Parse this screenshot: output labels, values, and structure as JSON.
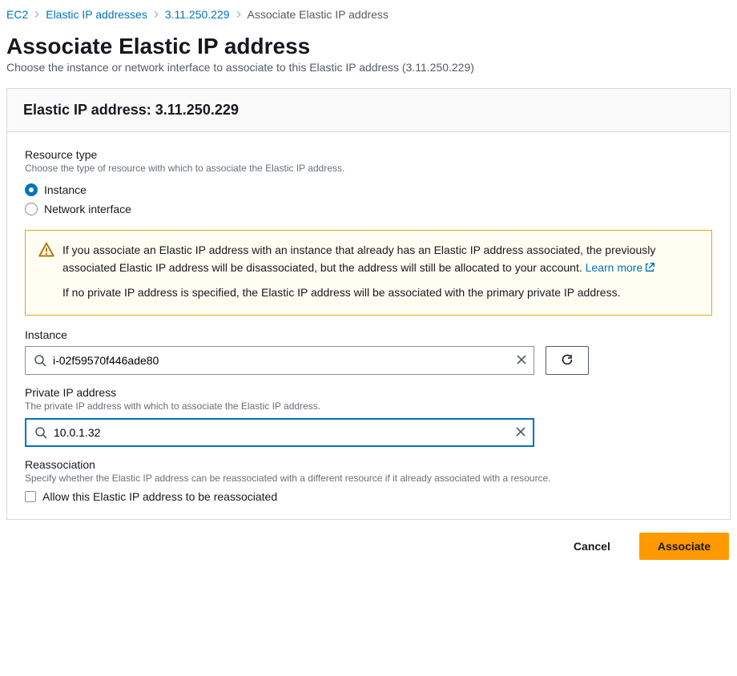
{
  "breadcrumb": {
    "items": [
      {
        "label": "EC2"
      },
      {
        "label": "Elastic IP addresses"
      },
      {
        "label": "3.11.250.229"
      }
    ],
    "current": "Associate Elastic IP address"
  },
  "header": {
    "title": "Associate Elastic IP address",
    "subtitle": "Choose the instance or network interface to associate to this Elastic IP address (3.11.250.229)"
  },
  "panel": {
    "title": "Elastic IP address: 3.11.250.229"
  },
  "resource_type": {
    "label": "Resource type",
    "help": "Choose the type of resource with which to associate the Elastic IP address.",
    "options": {
      "instance": "Instance",
      "network_interface": "Network interface"
    },
    "selected": "instance"
  },
  "warning": {
    "p1_before": "If you associate an Elastic IP address with an instance that already has an Elastic IP address associated, the previously associated Elastic IP address will be disassociated, but the address will still be allocated to your account. ",
    "learn_more": "Learn more",
    "p2": "If no private IP address is specified, the Elastic IP address will be associated with the primary private IP address."
  },
  "instance": {
    "label": "Instance",
    "value": "i-02f59570f446ade80"
  },
  "private_ip": {
    "label": "Private IP address",
    "help": "The private IP address with which to associate the Elastic IP address.",
    "value": "10.0.1.32"
  },
  "reassociation": {
    "label": "Reassociation",
    "help": "Specify whether the Elastic IP address can be reassociated with a different resource if it already associated with a resource.",
    "checkbox_label": "Allow this Elastic IP address to be reassociated",
    "checked": false
  },
  "footer": {
    "cancel": "Cancel",
    "submit": "Associate"
  }
}
